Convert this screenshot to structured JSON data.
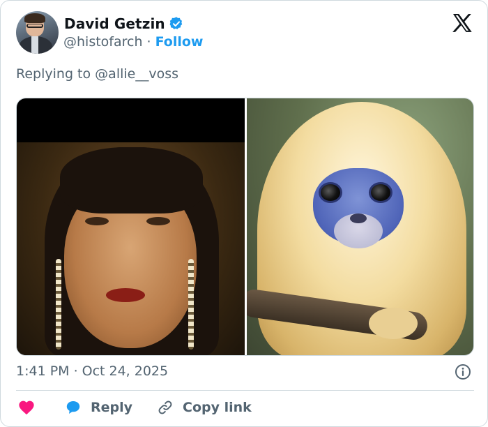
{
  "author": {
    "display_name": "David Getzin",
    "handle": "@histofarch",
    "separator": "·",
    "follow_label": "Follow",
    "verified": true
  },
  "reply_context": {
    "prefix": "Replying to",
    "mention": "@allie__voss"
  },
  "meta": {
    "time": "1:41 PM",
    "separator": "·",
    "date": "Oct 24, 2025"
  },
  "actions": {
    "reply_label": "Reply",
    "copy_link_label": "Copy link"
  },
  "icons": {
    "like": "heart-icon",
    "reply": "speech-bubble-icon",
    "copy": "link-icon",
    "info": "info-icon",
    "brand": "x-logo-icon",
    "verified": "verified-badge-icon"
  },
  "colors": {
    "accent": "#1d9bf0",
    "like": "#f91880",
    "muted_text": "#536471",
    "primary_text": "#0f1419",
    "border": "#cfd9de"
  }
}
